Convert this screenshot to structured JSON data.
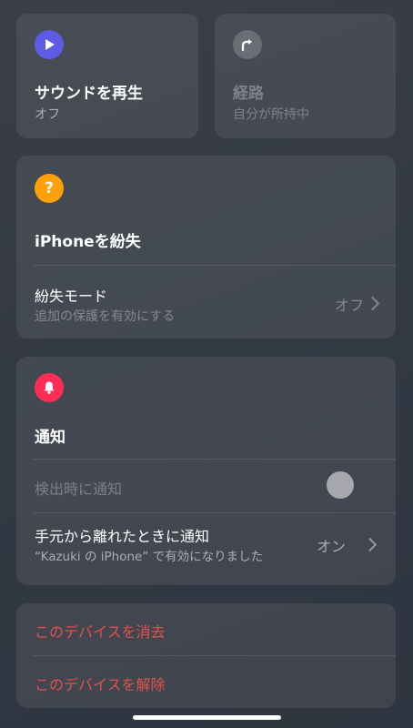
{
  "play_sound": {
    "title": "サウンドを再生",
    "status": "オフ",
    "icon": "play-icon",
    "icon_color": "#5e5ce6"
  },
  "directions": {
    "title": "経路",
    "status": "自分が所持中",
    "icon": "turn-arrow-icon",
    "icon_color": "#6b6f75"
  },
  "lost": {
    "header_title": "iPhoneを紛失",
    "icon": "question-icon",
    "icon_color": "#ff9f0a",
    "mode_label": "紛失モード",
    "mode_sub": "追加の保護を有効にする",
    "mode_value": "オフ"
  },
  "notifications": {
    "header_title": "通知",
    "icon": "bell-icon",
    "icon_color": "#ff2d55",
    "found_label": "検出時に通知",
    "left_behind_label": "手元から離れたときに通知",
    "left_behind_sub": "“Kazuki の iPhone” で有効になりました",
    "left_behind_value": "オン"
  },
  "actions": {
    "erase": "このデバイスを消去",
    "remove": "このデバイスを解除",
    "color": "#e3524a"
  }
}
